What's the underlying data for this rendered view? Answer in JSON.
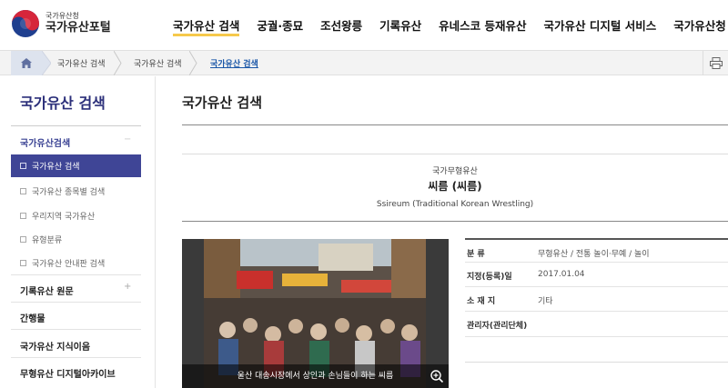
{
  "header": {
    "logo_small": "국가유산청",
    "logo_big": "국가유산포털",
    "nav": [
      {
        "label": "국가유산 검색"
      },
      {
        "label": "궁궐·종묘"
      },
      {
        "label": "조선왕릉"
      },
      {
        "label": "기록유산"
      },
      {
        "label": "유네스코 등재유산"
      },
      {
        "label": "국가유산 디지털 서비스"
      },
      {
        "label": "국가유산청 사진관"
      }
    ]
  },
  "breadcrumb": {
    "home_icon": "home-icon",
    "items": [
      "국가유산 검색",
      "국가유산 검색",
      "국가유산 검색"
    ],
    "print_icon": "printer-icon"
  },
  "sidebar": {
    "title": "국가유산 검색",
    "section_first": "국가유산검색",
    "active_item": "국가유산 검색",
    "sub_items": [
      "국가유산 종목별 검색",
      "우리지역 국가유산",
      "유형분류",
      "국가유산 안내판 검색"
    ],
    "sections": [
      "기록유산 원문",
      "간행물",
      "국가유산 지식이음",
      "무형유산 디지털아카이브"
    ]
  },
  "main": {
    "title": "국가유산 검색",
    "category": "국가무형유산",
    "name": "씨름 (씨름)",
    "name_en": "Ssireum (Traditional Korean Wrestling)",
    "photo_caption": "울산 대송시장에서 상인과 손님들이 하는 씨름",
    "info": [
      {
        "label": "분 류",
        "value": "무형유산 / 전통 놀이·무예 / 놀이"
      },
      {
        "label": "지정(등록)일",
        "value": "2017.01.04"
      },
      {
        "label": "소 재 지",
        "value": "기타"
      },
      {
        "label": "관리자(관리단체)",
        "value": ""
      }
    ]
  },
  "colors": {
    "brand_navy": "#2b2f7a",
    "active_bg": "#3f4596",
    "nav_underline": "#f6c94b",
    "link_blue": "#1a57a8"
  }
}
